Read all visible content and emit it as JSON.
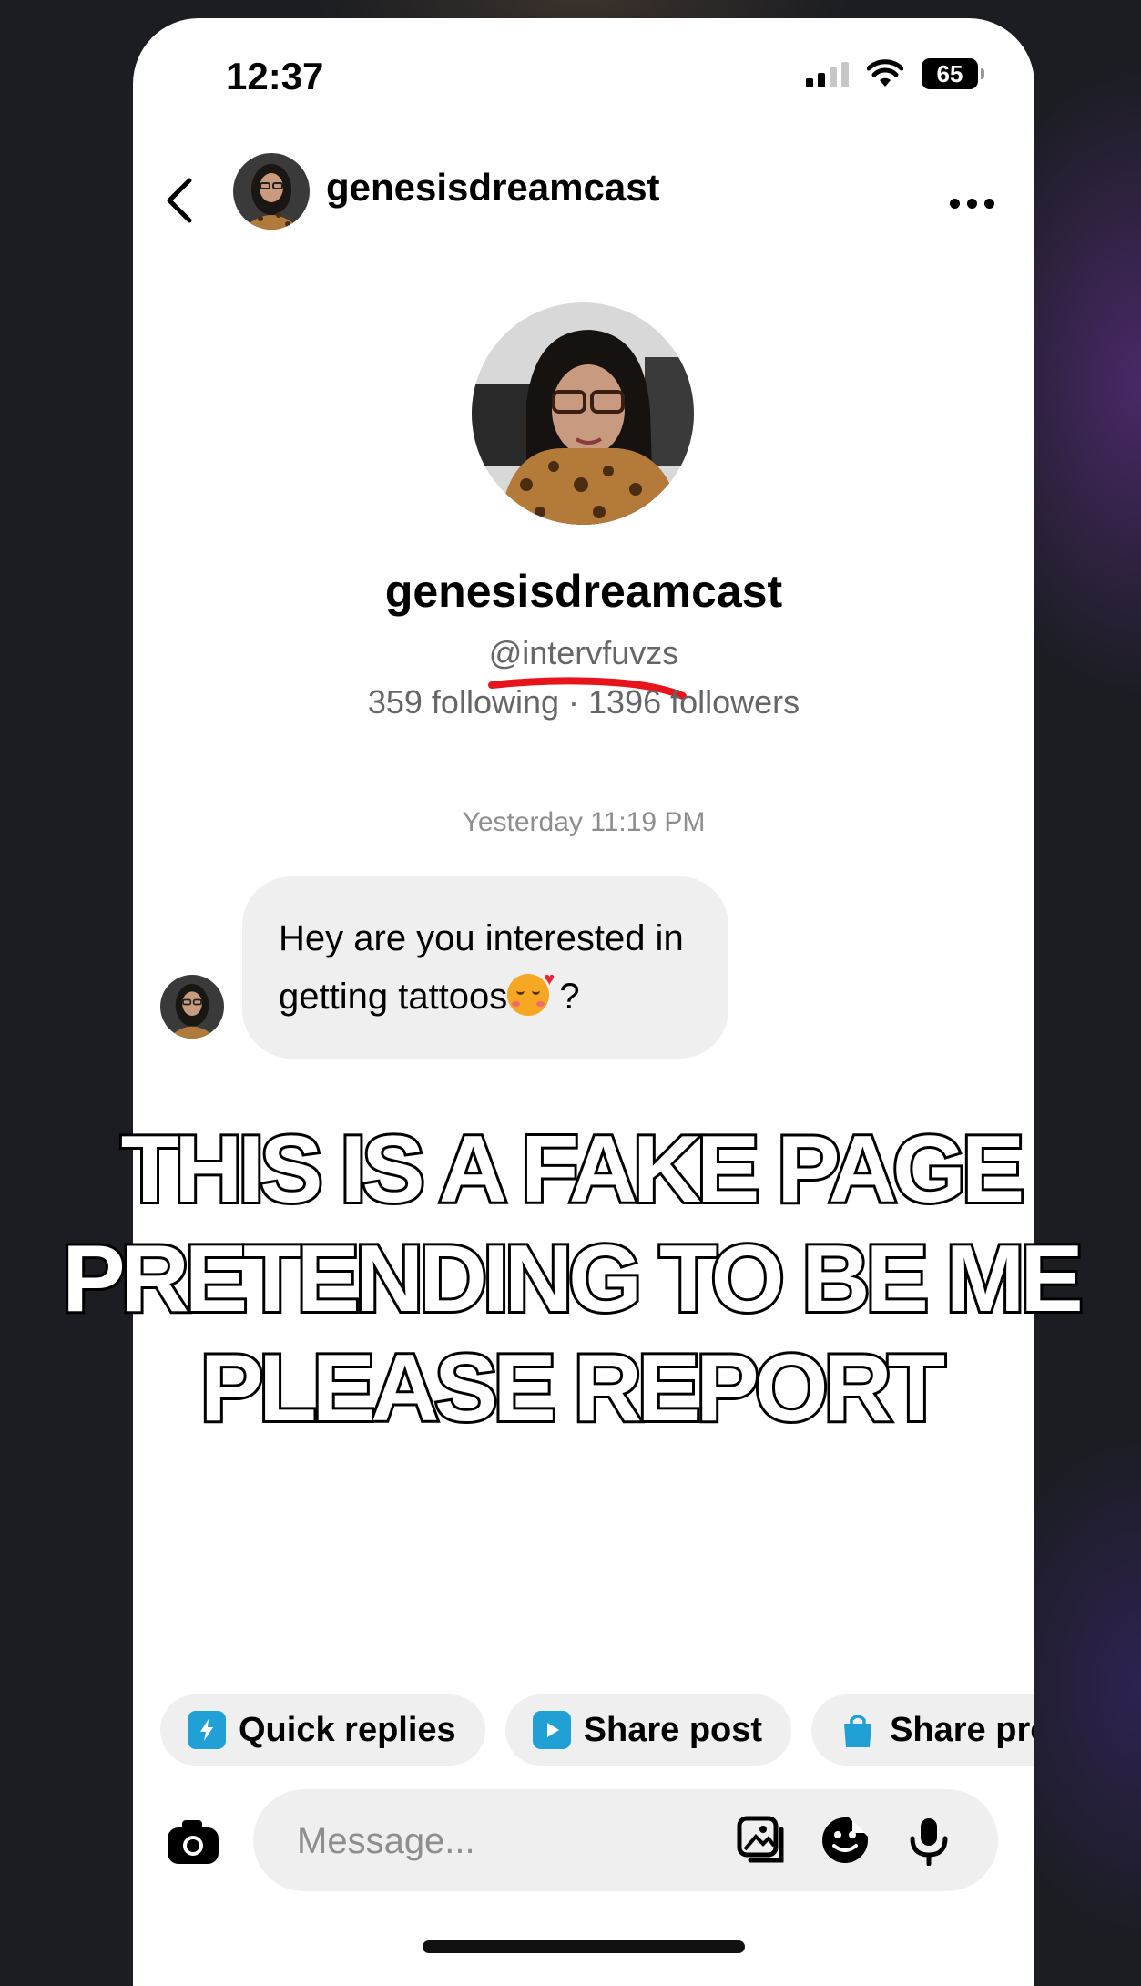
{
  "status_bar": {
    "time": "12:37",
    "battery": "65"
  },
  "header": {
    "username": "genesisdreamcast"
  },
  "profile": {
    "display_name": "genesisdreamcast",
    "handle": "@intervfuvzs",
    "stats": "359 following · 1396 followers"
  },
  "thread": {
    "timestamp": "Yesterday 11:19 PM",
    "message_line1": "Hey are you interested in",
    "message_line2": "getting tattoos",
    "message_end": " ?"
  },
  "overlay": {
    "line1": "THIS IS A FAKE PAGE",
    "line2": "PRETENDING TO BE ME",
    "line3": "PLEASE REPORT"
  },
  "quick_actions": [
    {
      "label": "Quick replies",
      "icon": "lightning-bubble-icon"
    },
    {
      "label": "Share post",
      "icon": "play-square-icon"
    },
    {
      "label": "Share pro",
      "icon": "shopping-bag-icon"
    }
  ],
  "composer": {
    "placeholder": "Message..."
  },
  "colors": {
    "accent": "#21a0d6",
    "annotation_red": "#e8141c"
  }
}
